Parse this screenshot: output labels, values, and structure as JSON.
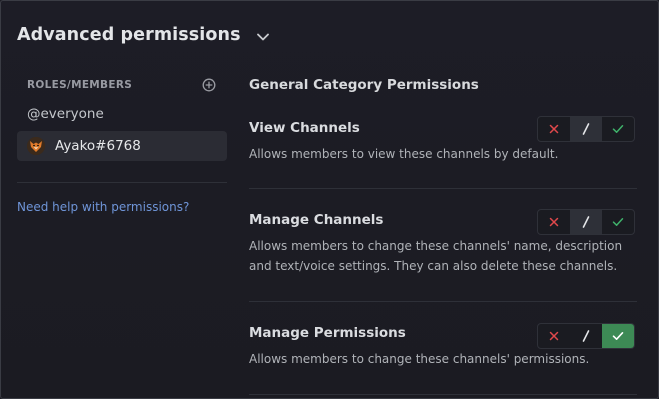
{
  "header": {
    "title": "Advanced permissions"
  },
  "sidebar": {
    "section_label": "ROLES/MEMBERS",
    "items": [
      {
        "label": "@everyone"
      },
      {
        "label": "Ayako#6768"
      }
    ],
    "help_link": "Need help with permissions?"
  },
  "main": {
    "section_title": "General Category Permissions",
    "permissions": [
      {
        "name": "View Channels",
        "description_lines": [
          "Allows members to view these channels by default."
        ],
        "state": "neutral"
      },
      {
        "name": "Manage Channels",
        "description_lines": [
          "Allows members to change these channels' name, description",
          "and text/voice settings. They can also delete these channels."
        ],
        "state": "neutral"
      },
      {
        "name": "Manage Permissions",
        "description_lines": [
          "Allows members to change these channels' permissions."
        ],
        "state": "allow"
      }
    ]
  },
  "colors": {
    "deny": "#e0484b",
    "neutral": "#e3e5e8",
    "allow": "#3d8a55",
    "link": "#6f95d8"
  },
  "icons": {
    "deny": "x-icon",
    "neutral": "slash-icon",
    "allow": "check-icon",
    "header": "chevron-down-icon",
    "add": "add-circle-icon"
  }
}
